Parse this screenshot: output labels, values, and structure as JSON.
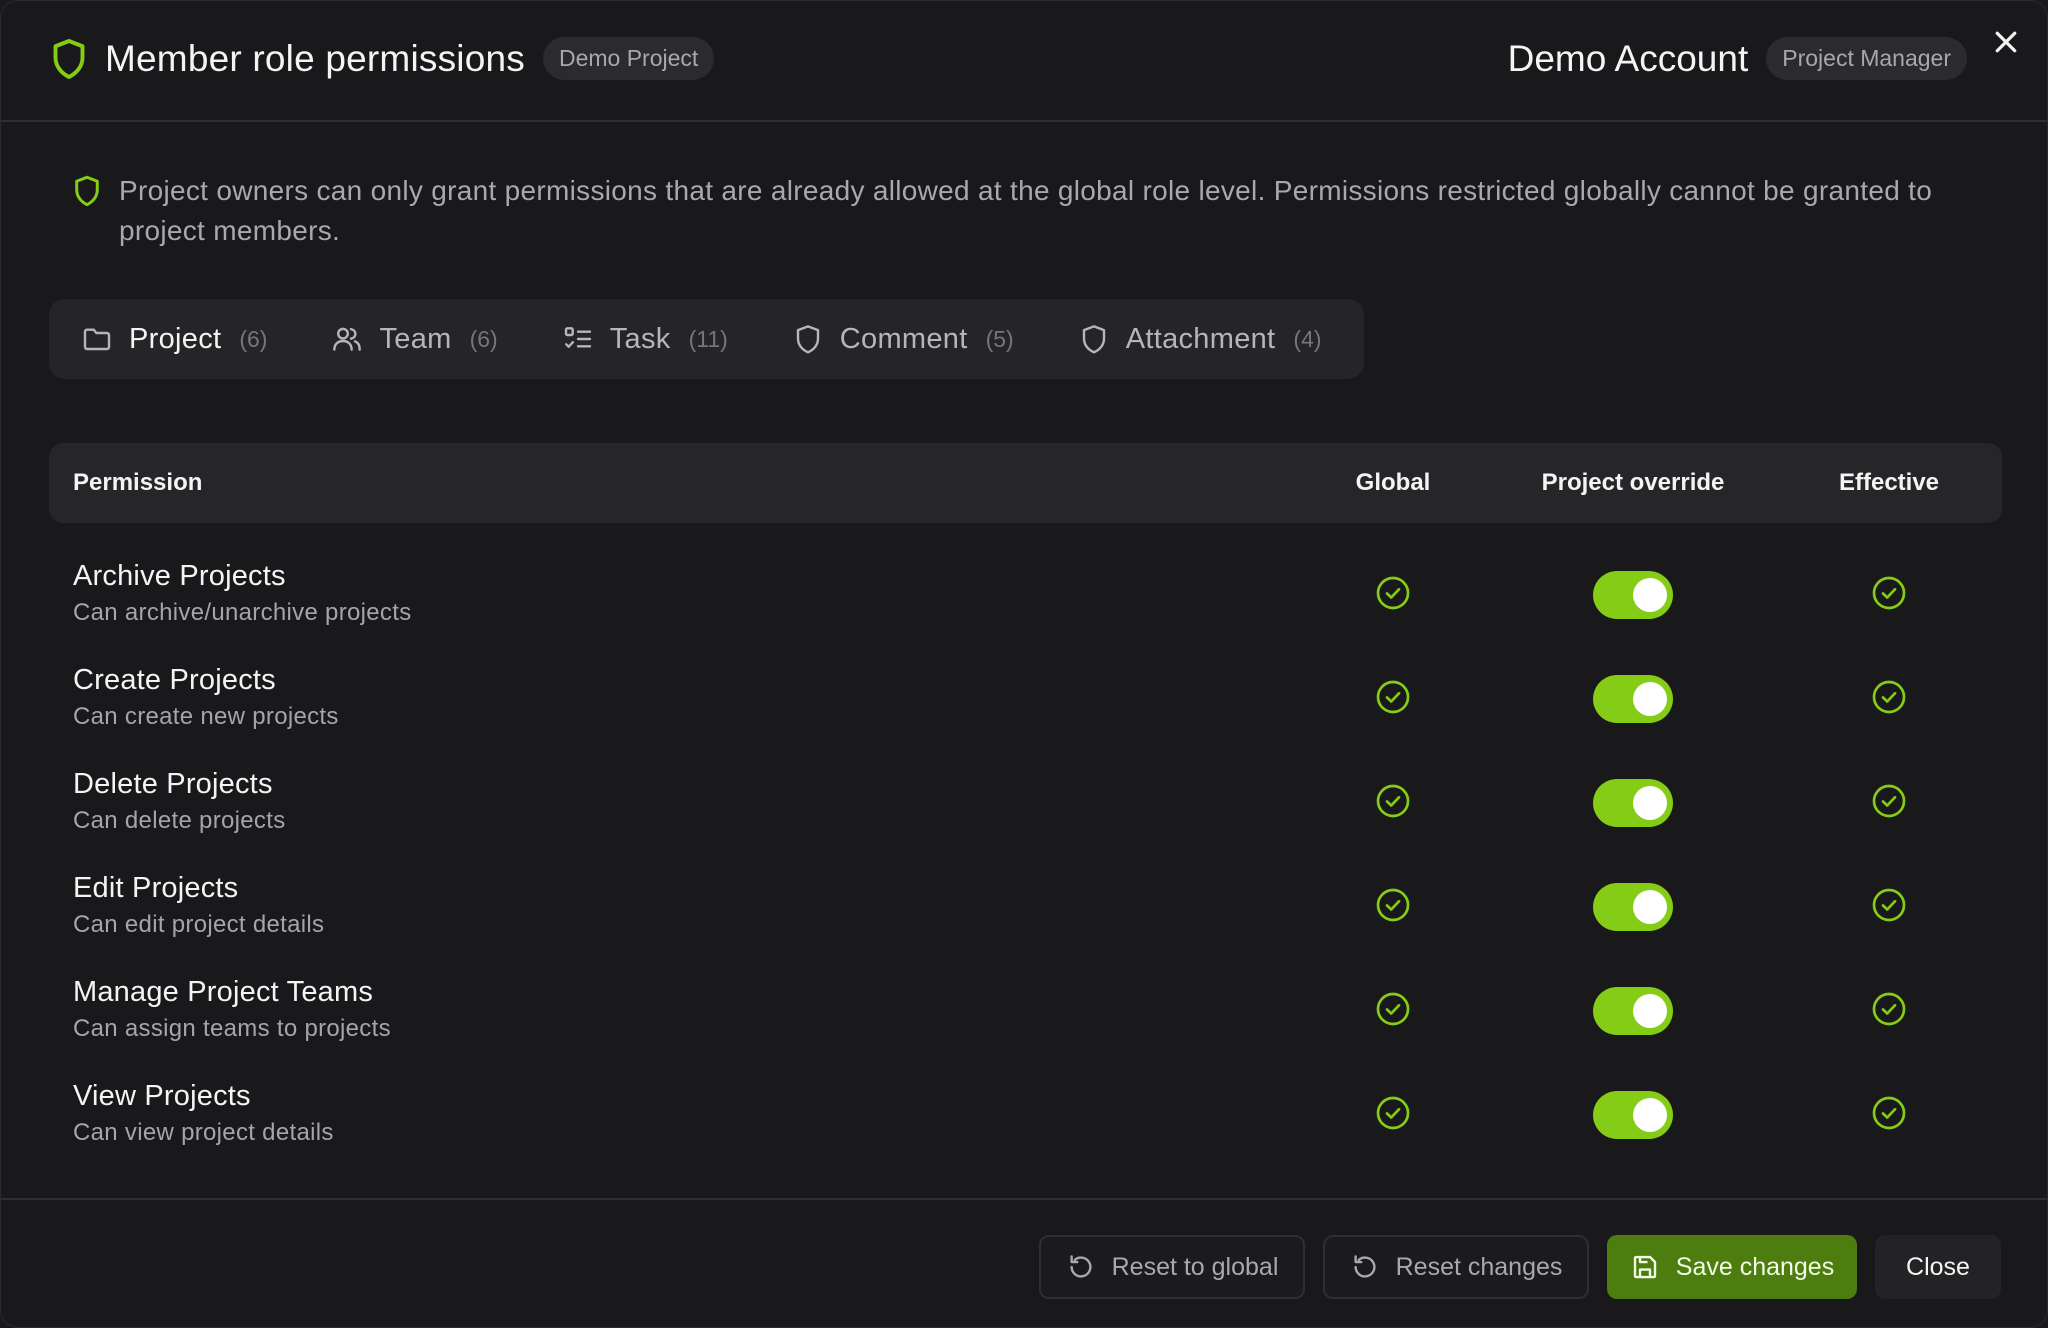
{
  "header": {
    "title": "Member role permissions",
    "project_badge": "Demo Project",
    "account_name": "Demo Account",
    "role_badge": "Project Manager"
  },
  "info": {
    "text": "Project owners can only grant permissions that are already allowed at the global role level. Permissions restricted globally cannot be granted to project members."
  },
  "tabs": [
    {
      "label": "Project",
      "count": "(6)",
      "icon": "folder-icon",
      "active": true
    },
    {
      "label": "Team",
      "count": "(6)",
      "icon": "users-icon",
      "active": false
    },
    {
      "label": "Task",
      "count": "(11)",
      "icon": "checklist-icon",
      "active": false
    },
    {
      "label": "Comment",
      "count": "(5)",
      "icon": "shield-icon",
      "active": false
    },
    {
      "label": "Attachment",
      "count": "(4)",
      "icon": "shield-icon",
      "active": false
    }
  ],
  "table": {
    "headers": {
      "permission": "Permission",
      "global": "Global",
      "override": "Project override",
      "effective": "Effective"
    },
    "rows": [
      {
        "name": "Archive Projects",
        "description": "Can archive/unarchive projects",
        "global": true,
        "override": true,
        "effective": true
      },
      {
        "name": "Create Projects",
        "description": "Can create new projects",
        "global": true,
        "override": true,
        "effective": true
      },
      {
        "name": "Delete Projects",
        "description": "Can delete projects",
        "global": true,
        "override": true,
        "effective": true
      },
      {
        "name": "Edit Projects",
        "description": "Can edit project details",
        "global": true,
        "override": true,
        "effective": true
      },
      {
        "name": "Manage Project Teams",
        "description": "Can assign teams to projects",
        "global": true,
        "override": true,
        "effective": true
      },
      {
        "name": "View Projects",
        "description": "Can view project details",
        "global": true,
        "override": true,
        "effective": true
      }
    ]
  },
  "footer": {
    "reset_global": "Reset to global",
    "reset_changes": "Reset changes",
    "save": "Save changes",
    "close": "Close"
  },
  "colors": {
    "accent": "#84cc16",
    "primary_button": "#4d7c0f",
    "background": "#19191b"
  }
}
